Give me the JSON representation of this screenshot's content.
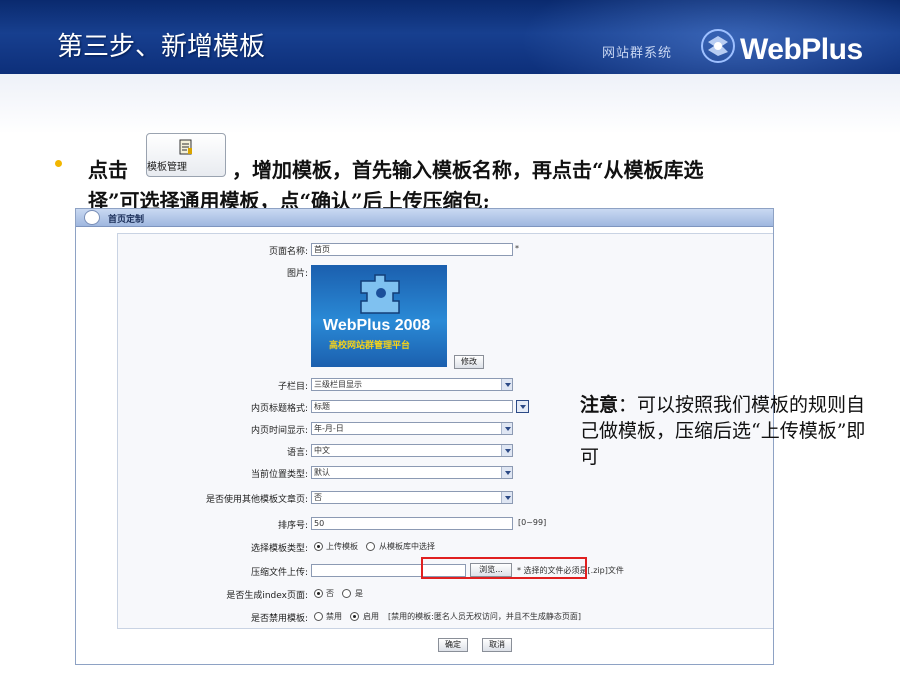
{
  "slide": {
    "title": "第三步、新增模板",
    "brand_sub": "网站群系统",
    "brand_name": "WebPlus"
  },
  "instruction": {
    "prefix": "点击",
    "button_label": "模板管理",
    "line1_rest": "，增加模板，首先输入模板名称，再点击“从模板库选",
    "line2": "择”可选择通用模板，点“确认”后上传压缩包;"
  },
  "panel": {
    "title": "首页定制",
    "fields": {
      "page_name_label": "页面名称:",
      "page_name_value": "首页",
      "required_mark": "*",
      "image_label": "图片:",
      "preview_name": "WebPlus 2008",
      "preview_sub": "高校网站群管理平台",
      "modify_button": "修改",
      "sub_column_label": "子栏目:",
      "sub_column_value": "三级栏目显示",
      "inner_title_label": "内页标题格式:",
      "inner_title_value": "标题",
      "inner_time_label": "内页时间显示:",
      "inner_time_value": "年-月-日",
      "language_label": "语言:",
      "language_value": "中文",
      "position_label": "当前位置类型:",
      "position_value": "默认",
      "other_template_label": "是否使用其他模板文章页:",
      "other_template_value": "否",
      "order_label": "排序号:",
      "order_value": "50",
      "order_range": "[0~99]",
      "template_type_label": "选择模板类型:",
      "template_type_upload": "上传模板",
      "template_type_library": "从模板库中选择",
      "upload_label": "压缩文件上传:",
      "browse_button": "浏览...",
      "upload_hint": "* 选择的文件必须是[.zip]文件",
      "gen_index_label": "是否生成index页面:",
      "gen_index_no": "否",
      "gen_index_yes": "是",
      "disable_label": "是否禁用模板:",
      "disable_off": "禁用",
      "disable_on": "启用",
      "disable_hint": "[禁用的模板:匿名人员无权访问，并且不生成静态页面]"
    },
    "confirm_button": "确定",
    "cancel_button": "取消"
  },
  "note": {
    "head": "注意",
    "text": "：可以按照我们模板的规则自己做模板，压缩后选“上传模板”即可"
  },
  "colors": {
    "header_blue": "#0d2f7a",
    "bullet_gold": "#f2b600",
    "alert_red": "#e02020"
  }
}
